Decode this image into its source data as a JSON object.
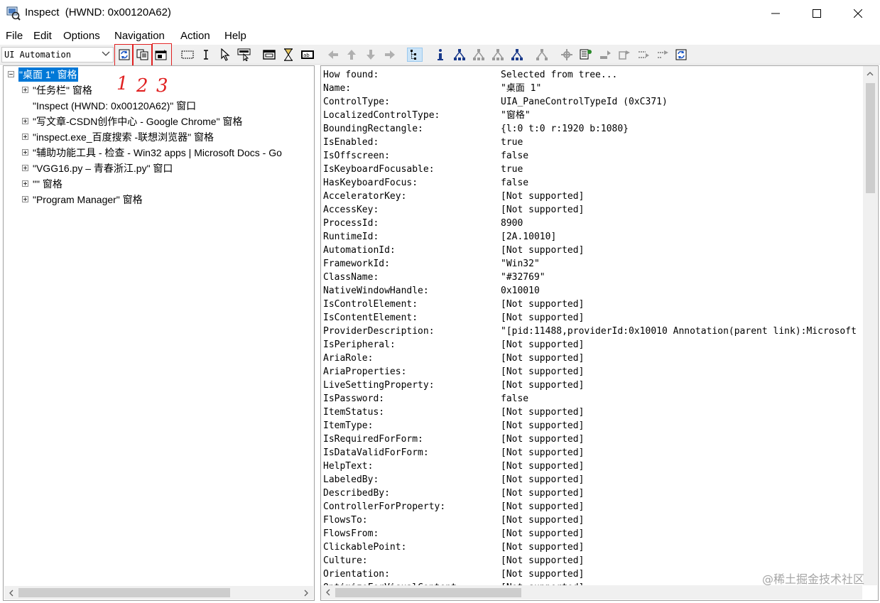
{
  "window": {
    "title": "Inspect  (HWND: 0x00120A62)",
    "icons": [
      "app-icon",
      "minimize-icon",
      "maximize-icon",
      "close-icon"
    ]
  },
  "menu": {
    "items": [
      "File",
      "Edit",
      "Options",
      "Navigation",
      "Action",
      "Help"
    ]
  },
  "toolbar": {
    "mode_selected": "UI Automation",
    "annotations": [
      "1",
      "2",
      "3"
    ],
    "buttons": [
      "refresh-icon",
      "copy-icon",
      "properties-icon",
      "rectangle-icon",
      "text-cursor-icon",
      "pointer-icon",
      "focus-track-icon",
      "window-frame-icon",
      "hourglass-icon",
      "text-box-icon",
      "nav-left-icon",
      "nav-up-icon",
      "nav-down-icon",
      "nav-right-icon",
      "tree-view-icon",
      "info-icon",
      "tree-parent-icon",
      "tree-first-child-icon",
      "tree-next-icon",
      "tree-prev-icon",
      "tree-last-icon",
      "settings-icon",
      "tree-settings-icon",
      "action-1-icon",
      "action-2-icon",
      "action-3-icon",
      "action-4-icon",
      "refresh-2-icon"
    ]
  },
  "tree": {
    "items": [
      {
        "label": "\"桌面 1\" 窗格",
        "expander": "minus",
        "selected": true
      },
      {
        "label": "\"任务栏\" 窗格",
        "expander": "plus"
      },
      {
        "label": "\"Inspect  (HWND: 0x00120A62)\" 窗口",
        "expander": "none"
      },
      {
        "label": "\"写文章-CSDN创作中心 - Google Chrome\" 窗格",
        "expander": "plus"
      },
      {
        "label": "\"inspect.exe_百度搜索 -联想浏览器\" 窗格",
        "expander": "plus"
      },
      {
        "label": "\"辅助功能工具 - 检查 - Win32 apps | Microsoft Docs - Go",
        "expander": "plus"
      },
      {
        "label": "\"VGG16.py – 青春浙江.py\" 窗口",
        "expander": "plus"
      },
      {
        "label": "\"\" 窗格",
        "expander": "plus"
      },
      {
        "label": "\"Program Manager\" 窗格",
        "expander": "plus"
      }
    ]
  },
  "details": {
    "rows": [
      {
        "name": "How found:",
        "value": "Selected from tree..."
      },
      {
        "name": "Name:",
        "value": "\"桌面 1\""
      },
      {
        "name": "ControlType:",
        "value": "UIA_PaneControlTypeId (0xC371)"
      },
      {
        "name": "LocalizedControlType:",
        "value": "\"窗格\""
      },
      {
        "name": "BoundingRectangle:",
        "value": "{l:0 t:0 r:1920 b:1080}"
      },
      {
        "name": "IsEnabled:",
        "value": "true"
      },
      {
        "name": "IsOffscreen:",
        "value": "false"
      },
      {
        "name": "IsKeyboardFocusable:",
        "value": "true"
      },
      {
        "name": "HasKeyboardFocus:",
        "value": "false"
      },
      {
        "name": "AcceleratorKey:",
        "value": "[Not supported]"
      },
      {
        "name": "AccessKey:",
        "value": "[Not supported]"
      },
      {
        "name": "ProcessId:",
        "value": "8900"
      },
      {
        "name": "RuntimeId:",
        "value": "[2A.10010]"
      },
      {
        "name": "AutomationId:",
        "value": "[Not supported]"
      },
      {
        "name": "FrameworkId:",
        "value": "\"Win32\""
      },
      {
        "name": "ClassName:",
        "value": "\"#32769\""
      },
      {
        "name": "NativeWindowHandle:",
        "value": "0x10010"
      },
      {
        "name": "IsControlElement:",
        "value": "[Not supported]"
      },
      {
        "name": "IsContentElement:",
        "value": "[Not supported]"
      },
      {
        "name": "ProviderDescription:",
        "value": "\"[pid:11488,providerId:0x10010 Annotation(parent link):Microsoft"
      },
      {
        "name": "IsPeripheral:",
        "value": "[Not supported]"
      },
      {
        "name": "AriaRole:",
        "value": "[Not supported]"
      },
      {
        "name": "AriaProperties:",
        "value": "[Not supported]"
      },
      {
        "name": "LiveSettingProperty:",
        "value": "[Not supported]"
      },
      {
        "name": "IsPassword:",
        "value": "false"
      },
      {
        "name": "ItemStatus:",
        "value": "[Not supported]"
      },
      {
        "name": "ItemType:",
        "value": "[Not supported]"
      },
      {
        "name": "IsRequiredForForm:",
        "value": "[Not supported]"
      },
      {
        "name": "IsDataValidForForm:",
        "value": "[Not supported]"
      },
      {
        "name": "HelpText:",
        "value": "[Not supported]"
      },
      {
        "name": "LabeledBy:",
        "value": "[Not supported]"
      },
      {
        "name": "DescribedBy:",
        "value": "[Not supported]"
      },
      {
        "name": "ControllerForProperty:",
        "value": "[Not supported]"
      },
      {
        "name": "FlowsTo:",
        "value": "[Not supported]"
      },
      {
        "name": "FlowsFrom:",
        "value": "[Not supported]"
      },
      {
        "name": "ClickablePoint:",
        "value": "[Not supported]"
      },
      {
        "name": "Culture:",
        "value": "[Not supported]"
      },
      {
        "name": "Orientation:",
        "value": "[Not supported]"
      },
      {
        "name": "OptimizeForVisualContent:",
        "value": "[Not supported]"
      }
    ]
  },
  "watermark": "@稀土掘金技术社区",
  "colors": {
    "selection": "#0078d7",
    "annotation_red": "#e02020",
    "toolbar_bg": "#f0f0f0"
  }
}
